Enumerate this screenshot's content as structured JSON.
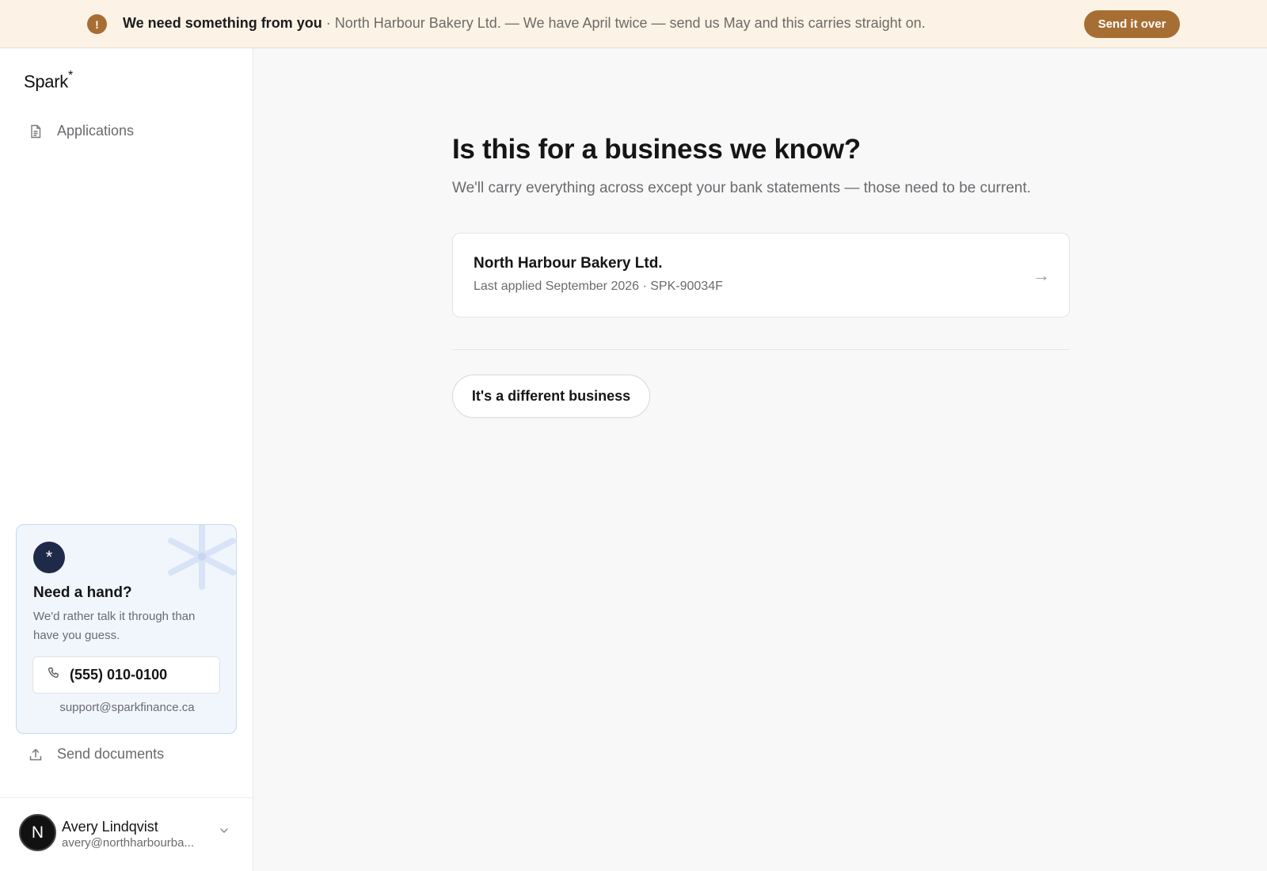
{
  "banner": {
    "title": "We need something from you",
    "separator": " · ",
    "message": "North Harbour Bakery Ltd. — We have April twice — send us May and this carries straight on.",
    "button_label": "Send it over",
    "icon_glyph": "!",
    "icon": "alert-icon",
    "accent_color": "#a76e34"
  },
  "sidebar": {
    "logo": "Spark",
    "logo_mark": "*",
    "nav_items": [
      {
        "label": "Applications",
        "icon": "document-icon"
      },
      {
        "label": "Send documents",
        "icon": "upload-icon"
      }
    ],
    "help": {
      "badge_glyph": "*",
      "title": "Need a hand?",
      "subtitle": "We'd rather talk it through than have you guess.",
      "phone": "(555) 010-0100",
      "email": "support@sparkfinance.ca"
    },
    "user": {
      "initial": "N",
      "name": "Avery Lindqvist",
      "email": "avery@northharbourba..."
    }
  },
  "main": {
    "title": "Is this for a business we know?",
    "subtitle": "We'll carry everything across except your bank statements — those need to be current.",
    "business": {
      "name": "North Harbour Bakery Ltd.",
      "meta": "Last applied September 2026 · SPK-90034F",
      "arrow": "→"
    },
    "different_button": "It's a different business"
  }
}
